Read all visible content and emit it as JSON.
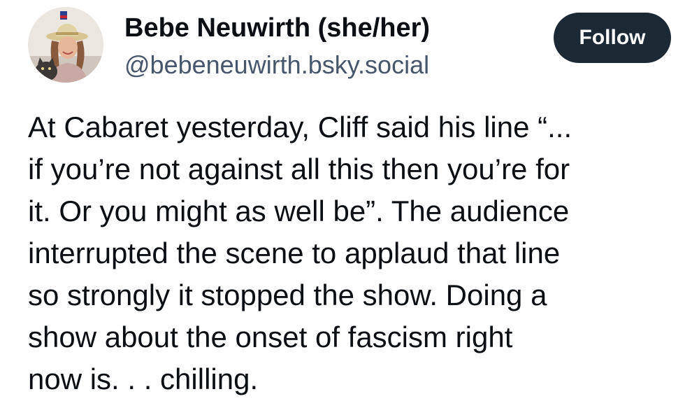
{
  "author": {
    "display_name": "Bebe Neuwirth (she/her)",
    "handle": "@bebeneuwirth.bsky.social",
    "avatar_icon": "profile-photo-woman-with-hat-and-cat"
  },
  "actions": {
    "follow_label": "Follow"
  },
  "colors": {
    "follow_button_bg": "#1c2834",
    "handle_text": "#47566a",
    "body_text": "#0b0f14"
  },
  "post": {
    "lines": [
      "At Cabaret yesterday, Cliff said his line “...",
      "if you’re not against all this then you’re for",
      "it. Or you might as well be”. The audience",
      "interrupted the scene to applaud that line",
      "so strongly it stopped the show. Doing a",
      "show about the onset of fascism right",
      "now is. . . chilling."
    ]
  }
}
